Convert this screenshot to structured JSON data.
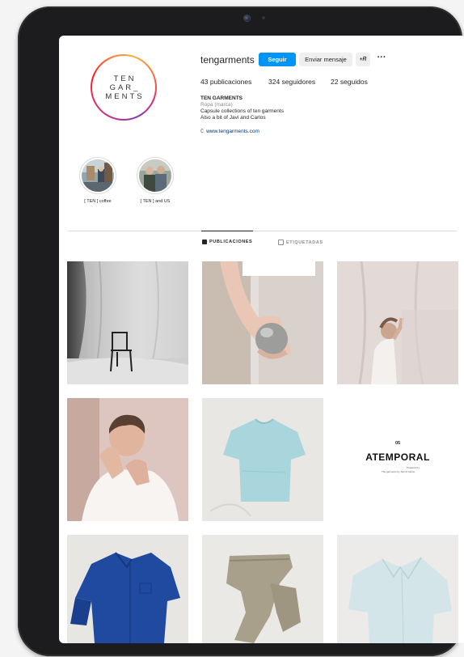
{
  "profile": {
    "username": "tengarments",
    "logo_lines": [
      "TEN",
      "GAR_",
      "MENTS"
    ],
    "follow_label": "Seguir",
    "message_label": "Enviar mensaje",
    "add_label": "+R",
    "more_label": "···",
    "stats": {
      "posts": "43 publicaciones",
      "followers": "324 seguidores",
      "following": "22 seguidos"
    },
    "bio": {
      "name": "TEN GARMENTS",
      "category": "Ropa (marca)",
      "lines": [
        "Capsule collections of ten garments",
        "Also a bit of Javi and Carlos"
      ],
      "link_icon": "🔗",
      "link": "www.tengarments.com"
    }
  },
  "highlights": [
    {
      "label": "[ TEN ] coffee",
      "icon": "coffee-shop-photo"
    },
    {
      "label": "[ TEN ] and US",
      "icon": "founders-photo"
    }
  ],
  "tabs": [
    {
      "label": "PUBLICACIONES",
      "active": true
    },
    {
      "label": "ETIQUETADAS",
      "active": false
    }
  ],
  "posts": [
    {
      "name": "chair-studio",
      "kind": "photo"
    },
    {
      "name": "hand-apple",
      "kind": "photo"
    },
    {
      "name": "person-curtain",
      "kind": "photo"
    },
    {
      "name": "portrait-white-shirt",
      "kind": "photo"
    },
    {
      "name": "light-blue-tee",
      "kind": "photo"
    },
    {
      "name": "atemporal-cover",
      "kind": "text",
      "number": "05",
      "title": "ATEMPORAL",
      "sub1": "Powered by",
      "sub2": "The garments by Javi & Carlos"
    },
    {
      "name": "blue-overshirt",
      "kind": "photo"
    },
    {
      "name": "khaki-trousers",
      "kind": "photo"
    },
    {
      "name": "light-blue-shirt",
      "kind": "photo"
    }
  ],
  "colors": {
    "accent": "#0095f6",
    "text": "#262626",
    "muted": "#8e8e8e",
    "link": "#00376b"
  }
}
